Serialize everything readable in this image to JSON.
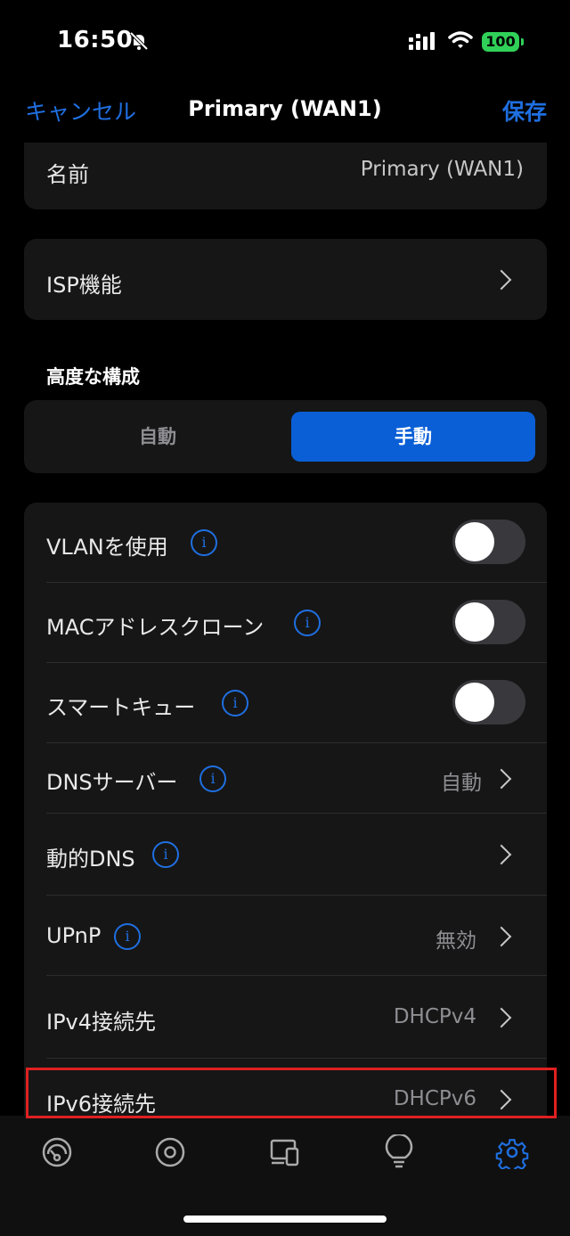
{
  "status_bar": {
    "time": "16:50",
    "battery": "100"
  },
  "nav": {
    "cancel": "キャンセル",
    "title": "Primary (WAN1)",
    "save": "保存"
  },
  "name_row": {
    "label": "名前",
    "value": "Primary (WAN1)"
  },
  "isp_row": {
    "label": "ISP機能"
  },
  "advanced": {
    "section_title": "高度な構成",
    "options": [
      "自動",
      "手動"
    ],
    "selected": "手動"
  },
  "settings": [
    {
      "label": "VLANを使用",
      "control": "toggle",
      "on": false
    },
    {
      "label": "MACアドレスクローン",
      "control": "toggle",
      "on": false
    },
    {
      "label": "スマートキュー",
      "control": "toggle",
      "on": false
    },
    {
      "label": "DNSサーバー",
      "value": "自動",
      "control": "chevron"
    },
    {
      "label": "動的DNS",
      "value": "",
      "control": "chevron"
    },
    {
      "label": "UPnP",
      "value": "無効",
      "control": "chevron"
    },
    {
      "label": "IPv4接続先",
      "value": "DHCPv4",
      "control": "chevron"
    },
    {
      "label": "IPv6接続先",
      "value": "DHCPv6",
      "control": "chevron"
    }
  ],
  "tabbar": {
    "icons": [
      "dashboard-icon",
      "devices-circle-icon",
      "clients-icon",
      "insights-bulb-icon",
      "settings-gear-icon"
    ],
    "active": "settings-gear-icon"
  },
  "colors": {
    "accent": "#1f6fe0",
    "highlight": "#e02020"
  }
}
